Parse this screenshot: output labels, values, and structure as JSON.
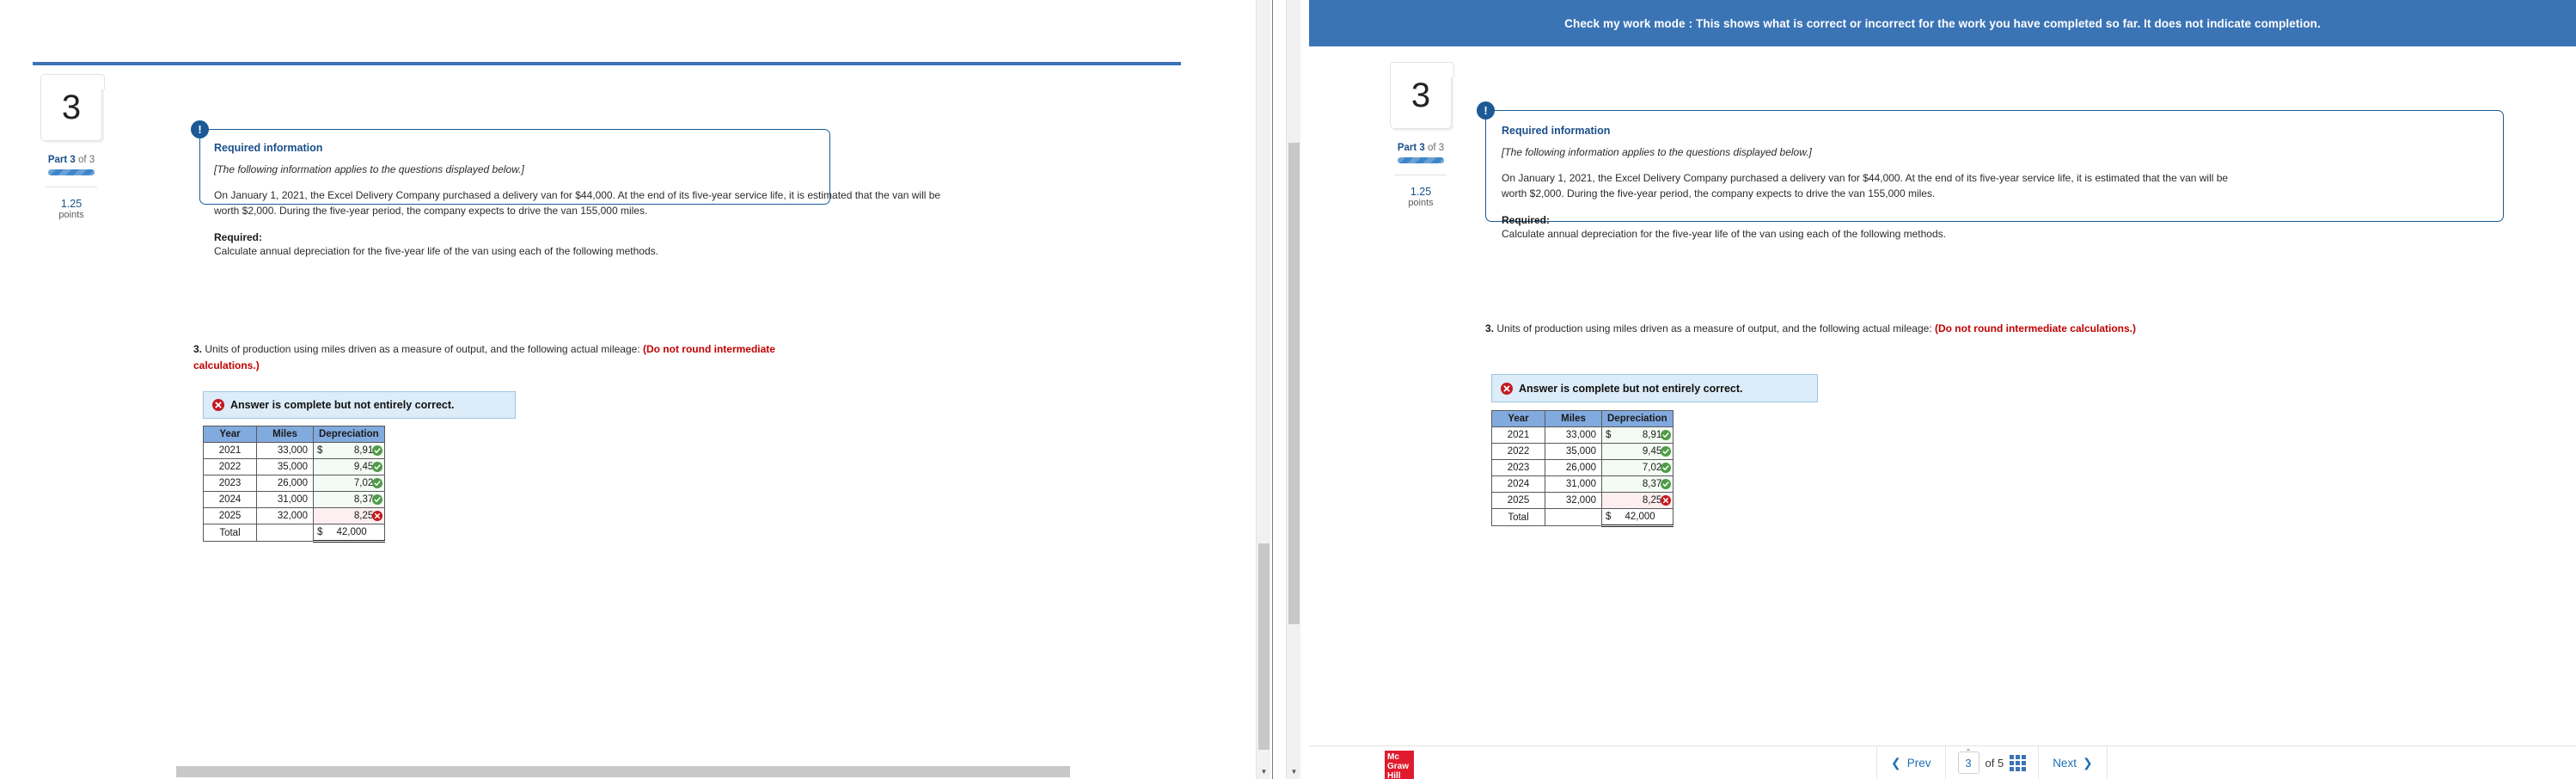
{
  "banner": {
    "text": "Check my work mode : This shows what is correct or incorrect for the work you have completed so far. It does not indicate completion.",
    "color": "#3b74b5"
  },
  "question_sidebar": {
    "number": "3",
    "part_prefix": "Part 3",
    "part_suffix": " of 3",
    "points_value": "1.25",
    "points_label": "points"
  },
  "required_info": {
    "icon": "exclamation-icon",
    "title": "Required information",
    "italic_note": "[The following information applies to the questions displayed below.]",
    "body": "On January 1, 2021, the Excel Delivery Company purchased a delivery van for $44,000. At the end of its five-year service life, it is estimated that the van will be worth $2,000. During the five-year period, the company expects to drive the van 155,000 miles.",
    "required_label": "Required:",
    "required_text": "Calculate annual depreciation for the five-year life of the van using each of the following methods."
  },
  "question": {
    "number": "3.",
    "text": " Units of production using miles driven as a measure of output, and the following actual mileage: ",
    "warning": "(Do not round intermediate calculations.)"
  },
  "alert": {
    "icon": "error-circle-icon",
    "text": "Answer is complete but not entirely correct.",
    "bg_color": "#dcecf8",
    "border_color": "#9fc5e2",
    "icon_color": "#c3191e"
  },
  "table": {
    "headers": [
      "Year",
      "Miles",
      "Depreciation"
    ],
    "rows": [
      {
        "year": "2021",
        "miles": "33,000",
        "dollar": "$",
        "dep": "8,910",
        "status": "correct"
      },
      {
        "year": "2022",
        "miles": "35,000",
        "dollar": "",
        "dep": "9,450",
        "status": "correct"
      },
      {
        "year": "2023",
        "miles": "26,000",
        "dollar": "",
        "dep": "7,020",
        "status": "correct"
      },
      {
        "year": "2024",
        "miles": "31,000",
        "dollar": "",
        "dep": "8,370",
        "status": "correct"
      },
      {
        "year": "2025",
        "miles": "32,000",
        "dollar": "",
        "dep": "8,250",
        "status": "incorrect"
      }
    ],
    "total": {
      "year": "Total",
      "miles": "",
      "dollar": "$",
      "dep": "42,000"
    },
    "header_bg": "#81aade",
    "correct_color": "#4e9c46",
    "incorrect_color": "#c3191e"
  },
  "footer": {
    "logo": {
      "line1": "Mc",
      "line2": "Graw",
      "line3": "Hill",
      "color": "#e01b2e"
    },
    "prev_label": "Prev",
    "next_label": "Next",
    "page_current": "3",
    "page_of": "of 5",
    "grid_icon": "grid-view-icon"
  }
}
